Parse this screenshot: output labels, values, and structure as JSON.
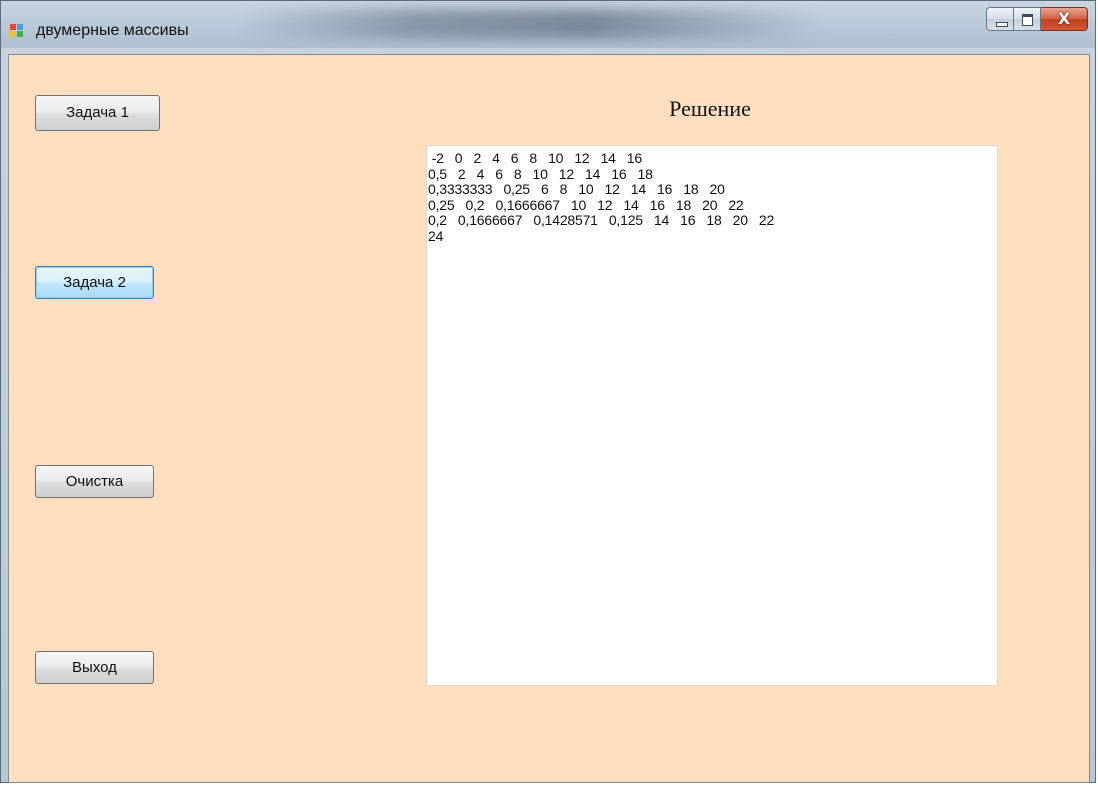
{
  "window": {
    "title": "двумерные массивы",
    "controls": {
      "minimize": "minimize",
      "maximize": "maximize",
      "close_glyph": "X"
    }
  },
  "buttons": {
    "task1": "Задача 1",
    "task2": "Задача 2",
    "clear": "Очистка",
    "exit": "Выход"
  },
  "solution": {
    "title": "Решение",
    "lines": [
      " -2   0   2   4   6   8   10   12   14   16",
      "0,5   2   4   6   8   10   12   14   16   18",
      "0,3333333   0,25   6   8   10   12   14   16   18   20",
      "0,25   0,2   0,1666667   10   12   14   16   18   20   22",
      "0,2   0,1666667   0,1428571   0,125   14   16   18   20   22",
      "24"
    ]
  },
  "colors": {
    "form_background": "#ffdfbf",
    "focused_button_border": "#3c7fb1",
    "close_button": "#c1401f"
  }
}
